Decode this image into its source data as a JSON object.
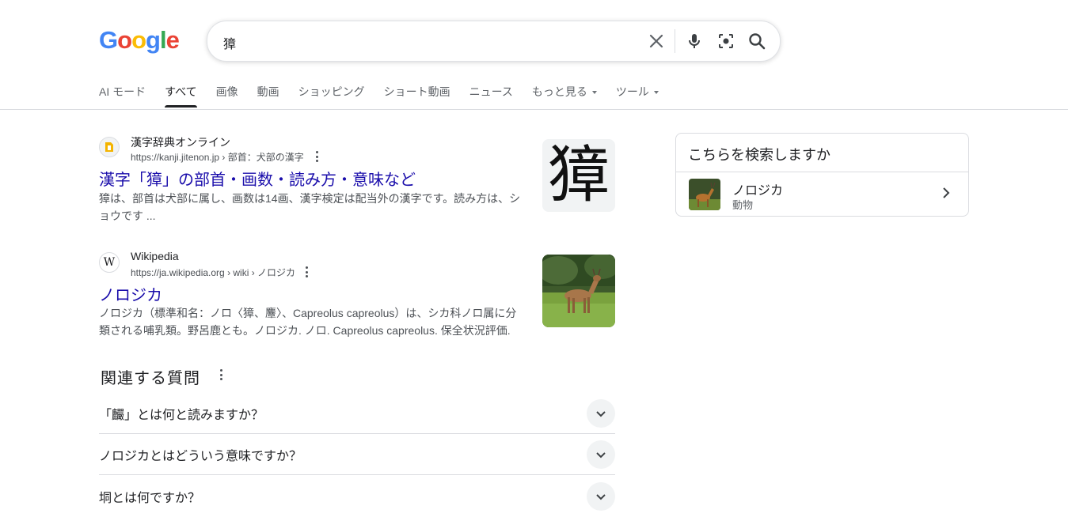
{
  "logo": {
    "letters": [
      "G",
      "o",
      "o",
      "g",
      "l",
      "e"
    ],
    "colors": [
      "#4285f4",
      "#ea4335",
      "#fbbc05",
      "#4285f4",
      "#34a853",
      "#ea4335"
    ]
  },
  "search": {
    "query": "獐",
    "clear_icon": "close-icon",
    "voice_icon": "mic-icon",
    "lens_icon": "camera-icon",
    "search_icon": "search-icon"
  },
  "tabs": [
    {
      "label": "AI モード",
      "active": false
    },
    {
      "label": "すべて",
      "active": true
    },
    {
      "label": "画像",
      "active": false
    },
    {
      "label": "動画",
      "active": false
    },
    {
      "label": "ショッピング",
      "active": false
    },
    {
      "label": "ショート動画",
      "active": false
    },
    {
      "label": "ニュース",
      "active": false
    },
    {
      "label": "もっと見る",
      "active": false,
      "dropdown": true
    },
    {
      "label": "ツール",
      "active": false,
      "dropdown": true
    }
  ],
  "results": [
    {
      "site_name": "漢字辞典オンライン",
      "url": "https://kanji.jitenon.jp › 部首：犬部の漢字",
      "title": "漢字「獐」の部首・画数・読み方・意味など",
      "snippet": "獐は、部首は犬部に属し、画数は14画、漢字検定は配当外の漢字です。読み方は、ショウです ...",
      "thumb_char": "獐"
    },
    {
      "site_name": "Wikipedia",
      "favicon_char": "W",
      "url": "https://ja.wikipedia.org › wiki › ノロジカ",
      "title": "ノロジカ",
      "snippet": "ノロジカ（標準和名：ノロ〈獐、麞〉、Capreolus capreolus）は、シカ科ノロ属に分類される哺乳類。野呂鹿とも。ノロジカ. ノロ. Capreolus capreolus. 保全状況評価."
    }
  ],
  "related_questions": {
    "heading": "関連する質問",
    "items": [
      "「麣」とは何と読みますか？",
      "ノロジカとはどういう意味ですか？",
      "垌とは何ですか？"
    ]
  },
  "side_panel": {
    "title": "こちらを検索しますか",
    "item_name": "ノロジカ",
    "item_sub": "動物"
  },
  "colors": {
    "link": "#1a0dab",
    "text": "#202124",
    "muted": "#4d5156",
    "border": "#dadce0"
  }
}
